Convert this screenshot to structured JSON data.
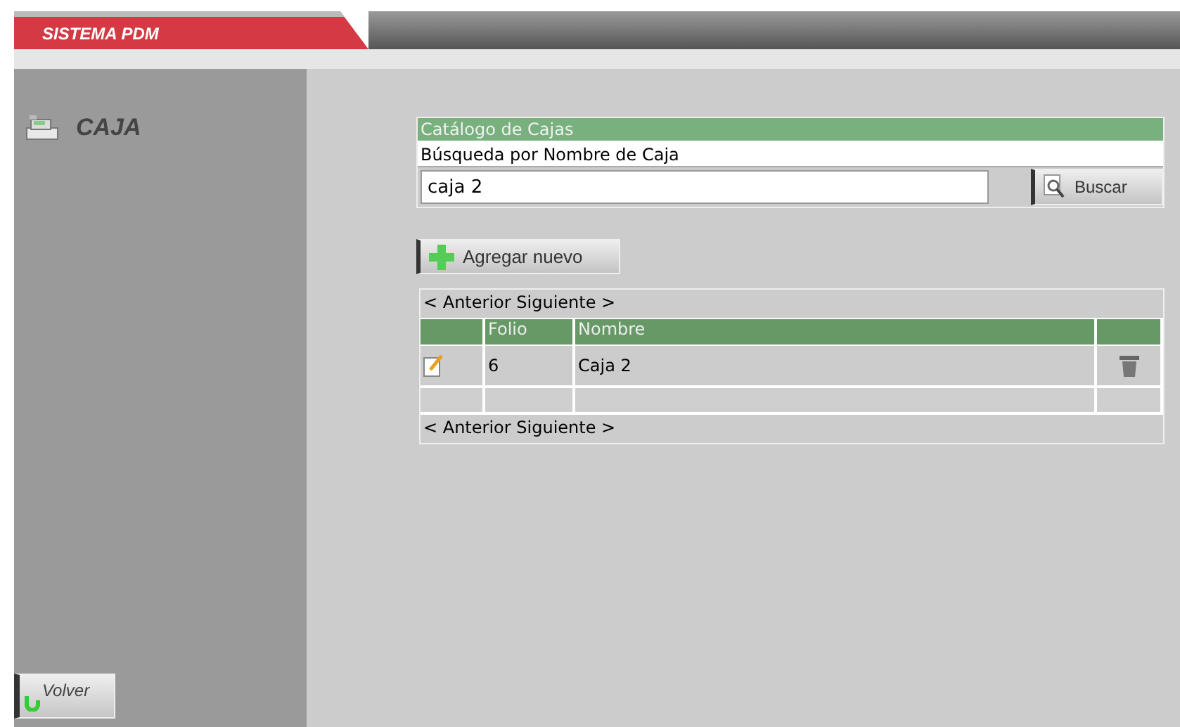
{
  "header": {
    "title": "SISTEMA PDM"
  },
  "sidebar": {
    "title": "CAJA",
    "back_button": "Volver"
  },
  "search_panel": {
    "title": "Catálogo de Cajas",
    "label": "Búsqueda por Nombre de Caja",
    "value": "caja 2",
    "button": "Buscar"
  },
  "add_button": "Agregar nuevo",
  "pager_top": {
    "prev": "< Anterior",
    "next": "Siguiente >"
  },
  "table": {
    "columns": [
      "",
      "Folio",
      "Nombre",
      ""
    ],
    "rows": [
      {
        "folio": "6",
        "nombre": "Caja 2"
      }
    ]
  },
  "pager_bottom": {
    "prev": "< Anterior",
    "next": "Siguiente >"
  }
}
